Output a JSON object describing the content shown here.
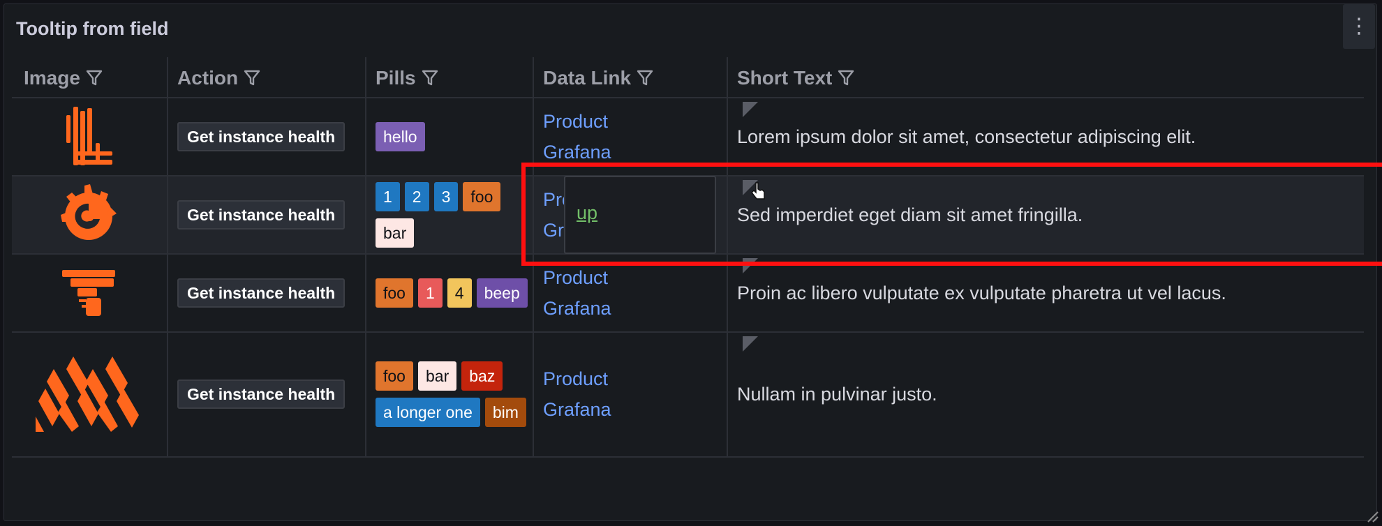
{
  "panel": {
    "title": "Tooltip from field",
    "menu_icon": "kebab-vertical-icon"
  },
  "columns": [
    {
      "label": "Image"
    },
    {
      "label": "Action"
    },
    {
      "label": "Pills"
    },
    {
      "label": "Data Link"
    },
    {
      "label": "Short Text"
    }
  ],
  "rows": [
    {
      "image": "tempo-logo",
      "action": "Get instance health",
      "pills": [
        {
          "text": "hello",
          "bg": "#7b5fb3",
          "fg": "#ffffff"
        }
      ],
      "link": [
        "Product",
        "Grafana"
      ],
      "text": "Lorem ipsum dolor sit amet, consectetur adipiscing elit."
    },
    {
      "image": "grafana-logo",
      "action": "Get instance health",
      "pills": [
        {
          "text": "1",
          "bg": "#1f78c1",
          "fg": "#ffffff"
        },
        {
          "text": "2",
          "bg": "#1f78c1",
          "fg": "#ffffff"
        },
        {
          "text": "3",
          "bg": "#1f78c1",
          "fg": "#ffffff"
        },
        {
          "text": "foo",
          "bg": "#e0752d",
          "fg": "#111217"
        },
        {
          "text": "bar",
          "bg": "#fde7e4",
          "fg": "#111217"
        }
      ],
      "link": [
        "Product",
        "Grafana"
      ],
      "text": "Sed imperdiet eget diam sit amet fringilla."
    },
    {
      "image": "pyroscope-logo",
      "action": "Get instance health",
      "pills": [
        {
          "text": "foo",
          "bg": "#e0752d",
          "fg": "#111217"
        },
        {
          "text": "1",
          "bg": "#e85a5a",
          "fg": "#ffffff"
        },
        {
          "text": "4",
          "bg": "#f2c55c",
          "fg": "#111217"
        },
        {
          "text": "beep",
          "bg": "#6e4fa8",
          "fg": "#ffffff"
        }
      ],
      "link": [
        "Product",
        "Grafana"
      ],
      "text": "Proin ac libero vulputate ex vulputate pharetra ut vel lacus."
    },
    {
      "image": "mimir-logo",
      "action": "Get instance health",
      "pills": [
        {
          "text": "foo",
          "bg": "#e0752d",
          "fg": "#111217"
        },
        {
          "text": "bar",
          "bg": "#fde7e4",
          "fg": "#111217"
        },
        {
          "text": "baz",
          "bg": "#c4240c",
          "fg": "#ffffff"
        },
        {
          "text": "a longer one",
          "bg": "#1f78c1",
          "fg": "#ffffff"
        },
        {
          "text": "bim",
          "bg": "#a34b0c",
          "fg": "#ffffff"
        }
      ],
      "link": [
        "Product",
        "Grafana"
      ],
      "text": "Nullam in pulvinar justo."
    }
  ],
  "tooltip": {
    "link_text": "up"
  },
  "colors": {
    "brand_orange": "#ff671d",
    "link_blue": "#6e9fff",
    "tooltip_link_green": "#73bf69",
    "highlight_red": "#ff1010"
  }
}
